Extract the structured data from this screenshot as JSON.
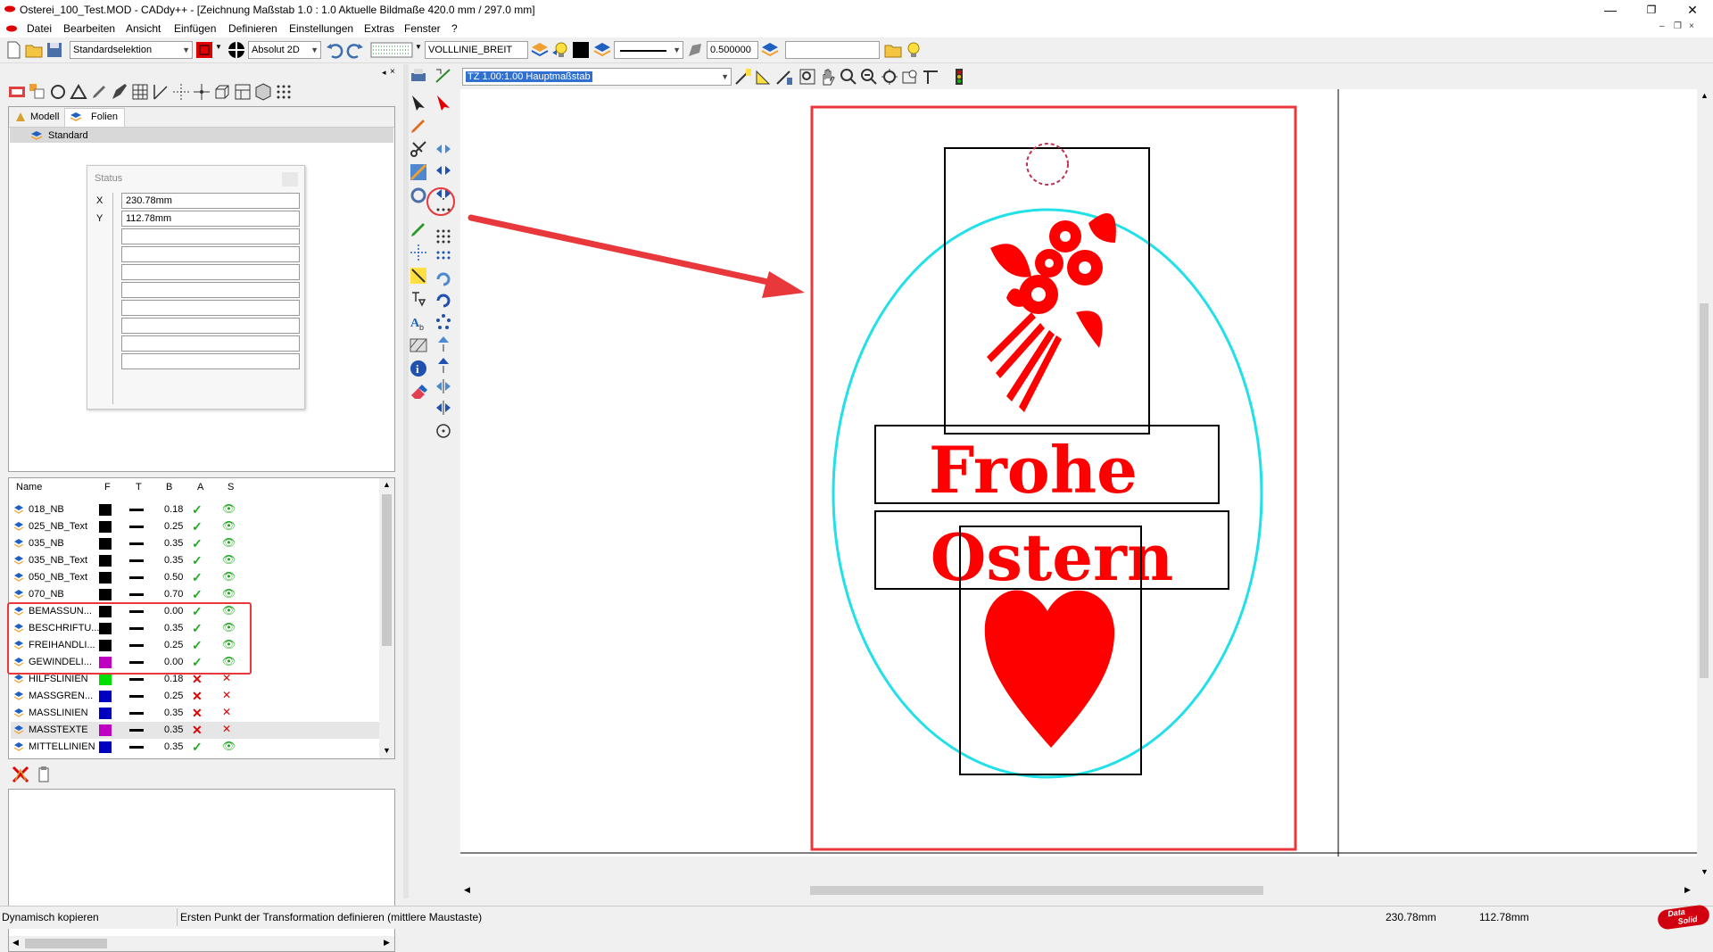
{
  "window": {
    "title": "Osterei_100_Test.MOD  -  CADdy++ - [Zeichnung   Maßstab 1.0 : 1.0   Aktuelle Bildmaße 420.0 mm / 297.0 mm]",
    "controls": [
      "—",
      "❐",
      "✕"
    ]
  },
  "menu": {
    "items": [
      "Datei",
      "Bearbeiten",
      "Ansicht",
      "Einfügen",
      "Definieren",
      "Einstellungen",
      "Extras",
      "Fenster",
      "?"
    ],
    "mdi": [
      "–",
      "❐",
      "×"
    ]
  },
  "toolbar": {
    "selection_mode": "Standardselektion",
    "coord_mode": "Absolut 2D",
    "linetype": "VOLLLINIE_BREIT",
    "line_width": "0.500000",
    "extra_field": ""
  },
  "view_toolbar": {
    "scale": "TZ 1.00:1.00 Hauptmaßstab"
  },
  "left_panel": {
    "tabs": [
      "Modell",
      "Folien"
    ],
    "tree_root": "Standard",
    "status": {
      "title": "Status",
      "x_label": "X",
      "x_value": "230.78mm",
      "y_label": "Y",
      "y_value": "112.78mm"
    },
    "layer_columns": [
      "Name",
      "F",
      "T",
      "B",
      "A",
      "S"
    ],
    "layers": [
      {
        "name": "018_NB",
        "color": "#000000",
        "width": "0.18",
        "active": "✓",
        "visible": "👁",
        "a_color": "#22aa22"
      },
      {
        "name": "025_NB_Text",
        "color": "#000000",
        "width": "0.25",
        "active": "✓",
        "visible": "👁",
        "a_color": "#22aa22"
      },
      {
        "name": "035_NB",
        "color": "#000000",
        "width": "0.35",
        "active": "✓",
        "visible": "👁",
        "a_color": "#22aa22"
      },
      {
        "name": "035_NB_Text",
        "color": "#000000",
        "width": "0.35",
        "active": "✓",
        "visible": "👁",
        "a_color": "#22aa22"
      },
      {
        "name": "050_NB_Text",
        "color": "#000000",
        "width": "0.50",
        "active": "✓",
        "visible": "👁",
        "a_color": "#22aa22"
      },
      {
        "name": "070_NB",
        "color": "#000000",
        "width": "0.70",
        "active": "✓",
        "visible": "👁",
        "a_color": "#22aa22"
      },
      {
        "name": "BEMASSUN...",
        "color": "#000000",
        "width": "0.00",
        "active": "✓",
        "visible": "👁",
        "a_color": "#22aa22"
      },
      {
        "name": "BESCHRIFTU...",
        "color": "#000000",
        "width": "0.35",
        "active": "✓",
        "visible": "👁",
        "a_color": "#22aa22"
      },
      {
        "name": "FREIHANDLI...",
        "color": "#000000",
        "width": "0.25",
        "active": "✓",
        "visible": "👁",
        "a_color": "#22aa22"
      },
      {
        "name": "GEWINDELI...",
        "color": "#c000c0",
        "width": "0.00",
        "active": "✓",
        "visible": "👁",
        "a_color": "#22aa22"
      },
      {
        "name": "HILFSLINIEN",
        "color": "#00e000",
        "width": "0.18",
        "active": "✕",
        "visible": "✕",
        "a_color": "#e00000"
      },
      {
        "name": "MASSGREN...",
        "color": "#0000c0",
        "width": "0.25",
        "active": "✕",
        "visible": "✕",
        "a_color": "#e00000"
      },
      {
        "name": "MASSLINIEN",
        "color": "#0000c0",
        "width": "0.35",
        "active": "✕",
        "visible": "✕",
        "a_color": "#e00000"
      },
      {
        "name": "MASSTEXTE",
        "color": "#c000c0",
        "width": "0.35",
        "active": "✕",
        "visible": "✕",
        "a_color": "#e00000"
      },
      {
        "name": "MITTELLINIEN",
        "color": "#0000c0",
        "width": "0.35",
        "active": "✓",
        "visible": "👁",
        "a_color": "#22aa22"
      }
    ]
  },
  "drawing": {
    "text_line1": "Frohe",
    "text_line2": "Ostern"
  },
  "status_bar": {
    "mode": "Dynamisch kopieren",
    "hint": "Ersten Punkt der Transformation definieren (mittlere Maustaste)",
    "x": "230.78mm",
    "y": "112.78mm",
    "logo_line1": "Data",
    "logo_line2": "Solid"
  },
  "colors": {
    "accent_red": "#e8383c",
    "ellipse": "#22e0e8",
    "drawing_red": "#ff0000"
  }
}
